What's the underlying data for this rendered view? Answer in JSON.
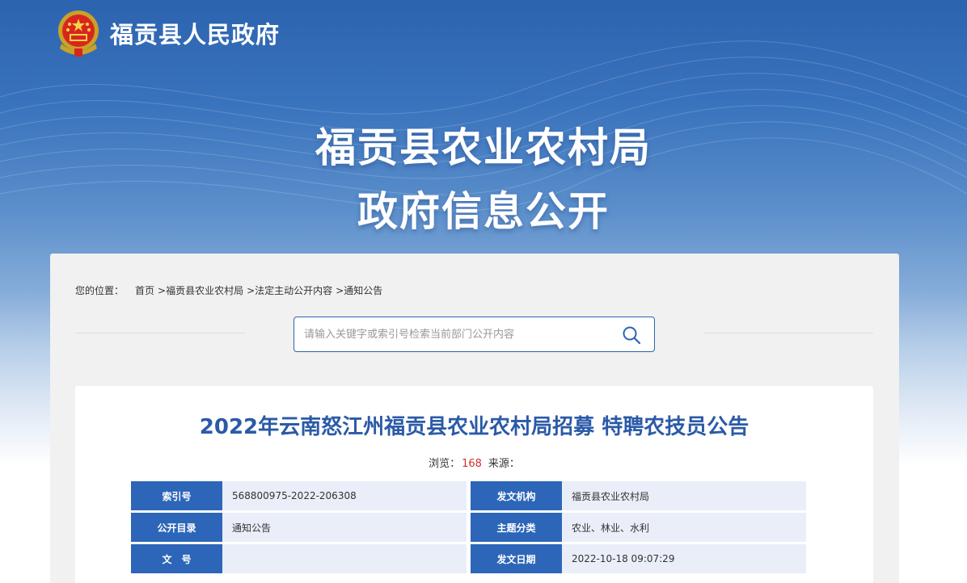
{
  "header": {
    "site_name": "福贡县人民政府",
    "headline_line1": "福贡县农业农村局",
    "headline_line2": "政府信息公开"
  },
  "breadcrumb": {
    "label": "您的位置：",
    "items": [
      "首页",
      ">福贡县农业农村局",
      ">法定主动公开内容",
      ">通知公告"
    ]
  },
  "search": {
    "placeholder": "请输入关键字或索引号检索当前部门公开内容"
  },
  "article": {
    "title": "2022年云南怒江州福贡县农业农村局招募 特聘农技员公告",
    "views_label": "浏览：",
    "views": "168",
    "source_label": "来源："
  },
  "info": {
    "rows": [
      [
        {
          "k": "索引号",
          "v": "568800975-2022-206308"
        },
        {
          "k": "发文机构",
          "v": "福贡县农业农村局"
        }
      ],
      [
        {
          "k": "公开目录",
          "v": "通知公告"
        },
        {
          "k": "主题分类",
          "v": "农业、林业、水利"
        }
      ],
      [
        {
          "k": "文　号",
          "v": ""
        },
        {
          "k": "发文日期",
          "v": "2022-10-18 09:07:29"
        }
      ]
    ]
  },
  "colors": {
    "brand_blue": "#2c63b0",
    "label_blue": "#2d66b8",
    "title_blue": "#2b5aa7",
    "views_red": "#d0312d"
  },
  "icons": [
    "national-emblem-icon",
    "search-icon"
  ]
}
